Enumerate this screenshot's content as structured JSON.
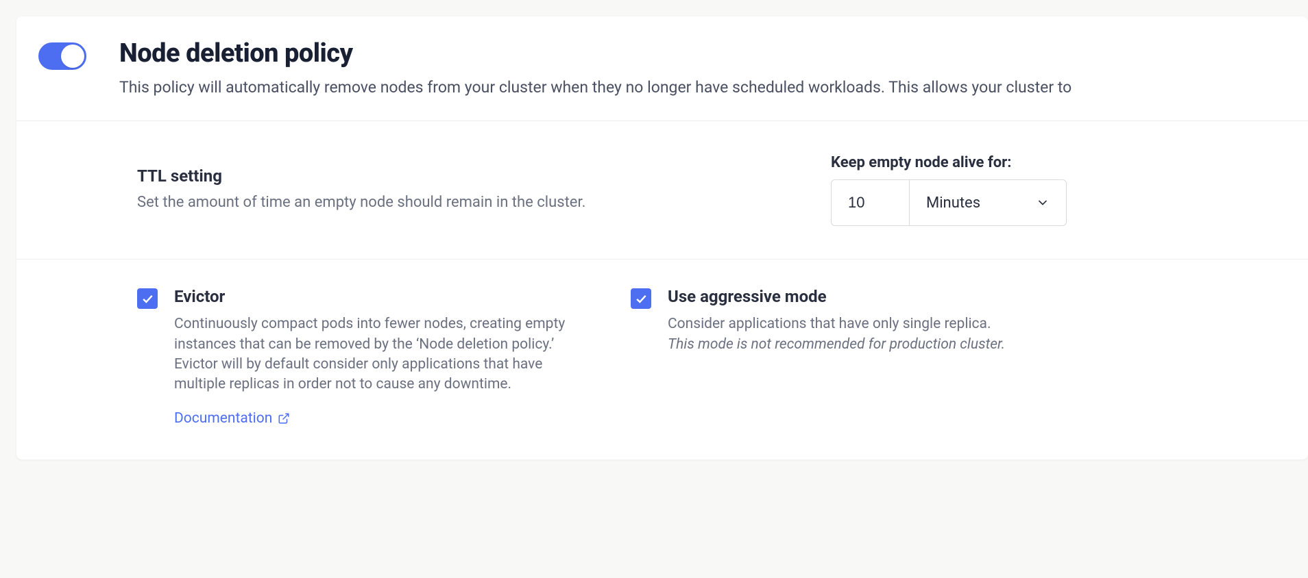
{
  "header": {
    "title": "Node deletion policy",
    "subtitle": "This policy will automatically remove nodes from your cluster when they no longer have scheduled workloads. This allows your cluster to",
    "toggle_on": true
  },
  "ttl": {
    "title": "TTL setting",
    "description": "Set the amount of time an empty node should remain in the cluster.",
    "label": "Keep empty node alive for:",
    "value": "10",
    "unit": "Minutes"
  },
  "evictor": {
    "title": "Evictor",
    "description": "Continuously compact pods into fewer nodes, creating empty instances that can be removed by the ‘Node deletion policy.’ Evictor will by default consider only applications that have multiple replicas in order not to cause any downtime.",
    "doc_link": "Documentation",
    "checked": true
  },
  "aggressive": {
    "title": "Use aggressive mode",
    "description_line1": "Consider applications that have only single replica.",
    "description_line2": "This mode is not recommended for production cluster.",
    "checked": true
  }
}
